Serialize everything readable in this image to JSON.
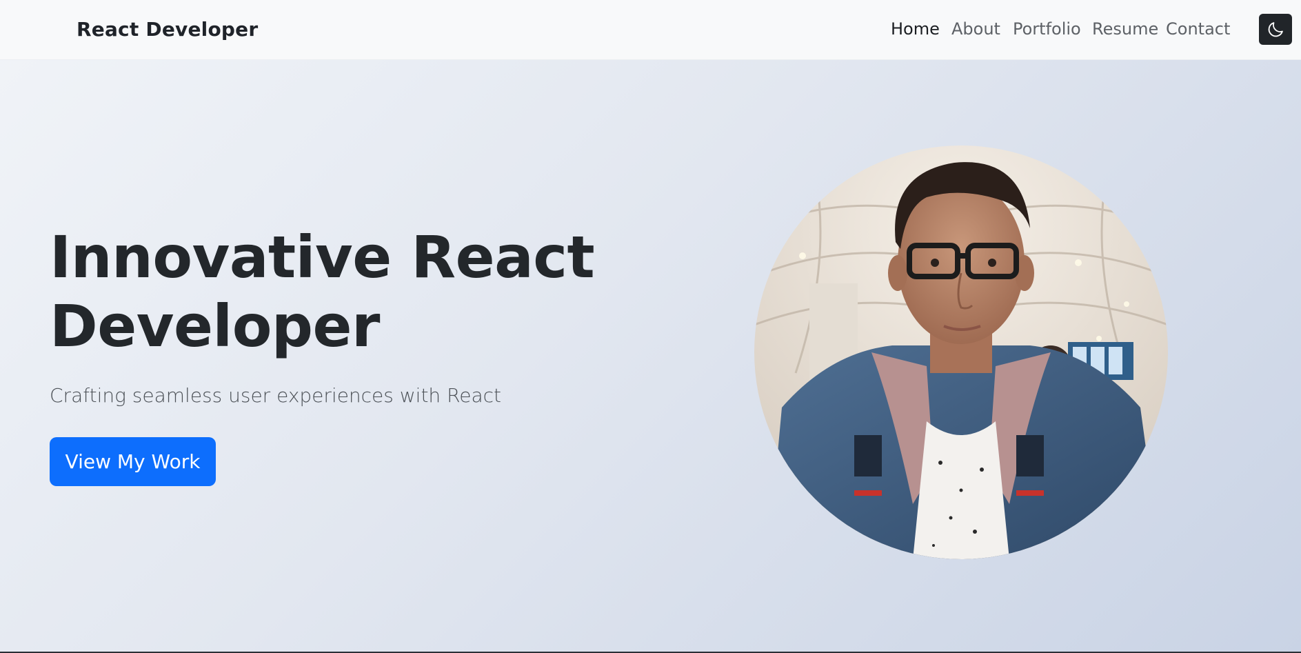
{
  "navbar": {
    "brand": "React Developer",
    "links": [
      {
        "label": "Home",
        "active": true
      },
      {
        "label": "About",
        "active": false
      },
      {
        "label": "Portfolio",
        "active": false
      },
      {
        "label": "Resume",
        "active": false
      },
      {
        "label": "Contact",
        "active": false
      }
    ],
    "theme_toggle_icon": "moon-icon"
  },
  "hero": {
    "title_line1": "Innovative React",
    "title_line2": "Developer",
    "subtitle": "Crafting seamless user experiences with React",
    "cta_label": "View My Work",
    "portrait_icon": "profile-photo"
  },
  "colors": {
    "primary": "#0d6efd",
    "dark": "#212529",
    "navbar_bg": "#f8f9fa"
  }
}
